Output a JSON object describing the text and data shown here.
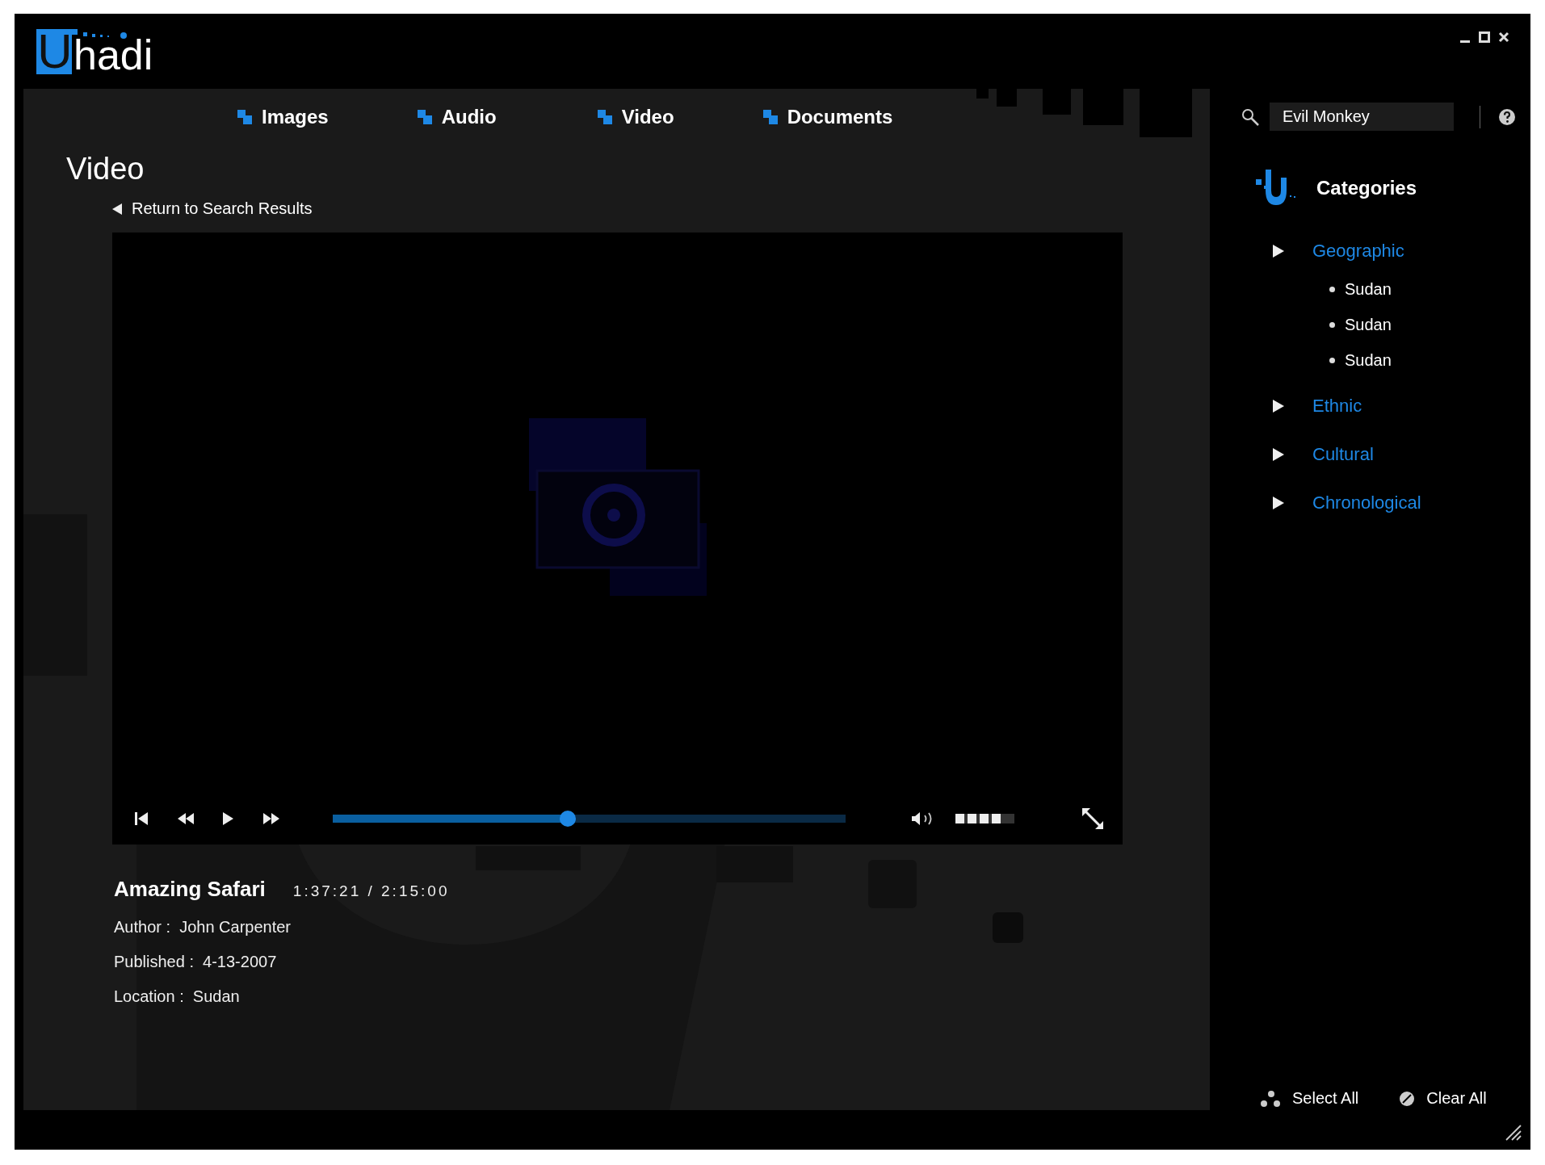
{
  "logo": {
    "mark": "U",
    "rest": "hadi"
  },
  "nav": {
    "tabs": [
      {
        "label": "Images"
      },
      {
        "label": "Audio"
      },
      {
        "label": "Video"
      },
      {
        "label": "Documents"
      }
    ]
  },
  "page": {
    "title": "Video",
    "back_link": "Return to Search Results"
  },
  "player": {
    "progress": {
      "level": 0.458
    },
    "volume": {
      "level": 0.8
    }
  },
  "media": {
    "title": "Amazing Safari",
    "time": "1:37:21 / 2:15:00",
    "fields": [
      "Author :  John Carpenter",
      "Published :  4-13-2007",
      "Location :  Sudan"
    ]
  },
  "sidebar": {
    "search": {
      "value": "Evil Monkey"
    },
    "categories_title": "Categories",
    "tree": [
      {
        "label": "Geographic",
        "children": [
          {
            "label": "Sudan"
          },
          {
            "label": "Sudan"
          },
          {
            "label": "Sudan"
          }
        ]
      },
      {
        "label": "Ethnic"
      },
      {
        "label": "Cultural"
      },
      {
        "label": "Chronological"
      }
    ],
    "actions": [
      {
        "kind": "select",
        "label": "Select All"
      },
      {
        "kind": "clear",
        "label": "Clear All"
      }
    ]
  }
}
